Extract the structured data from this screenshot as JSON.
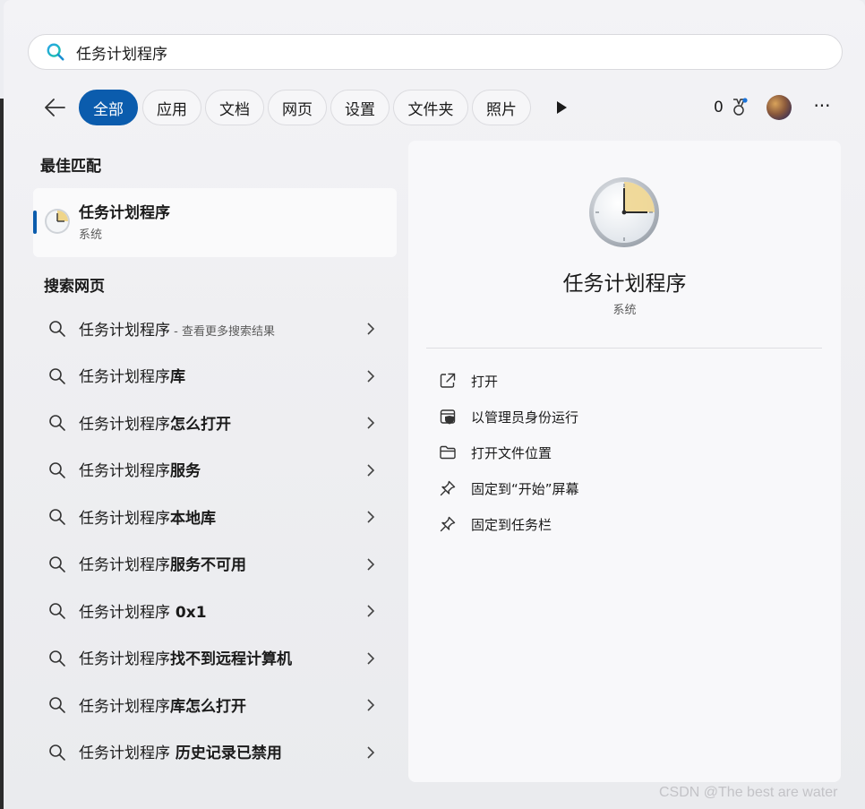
{
  "search": {
    "value": "任务计划程序",
    "icon": "search-icon"
  },
  "filters": {
    "tabs": [
      {
        "label": "全部",
        "active": true
      },
      {
        "label": "应用"
      },
      {
        "label": "文档"
      },
      {
        "label": "网页"
      },
      {
        "label": "设置"
      },
      {
        "label": "文件夹"
      },
      {
        "label": "照片"
      }
    ],
    "points": "0"
  },
  "best_match": {
    "heading": "最佳匹配",
    "title": "任务计划程序",
    "subtitle": "系统"
  },
  "web": {
    "heading": "搜索网页",
    "items": [
      {
        "base": "任务计划程序",
        "suffix": "",
        "hint": " - 查看更多搜索结果"
      },
      {
        "base": "任务计划程序",
        "suffix": "库",
        "hint": ""
      },
      {
        "base": "任务计划程序",
        "suffix": "怎么打开",
        "hint": ""
      },
      {
        "base": "任务计划程序",
        "suffix": "服务",
        "hint": ""
      },
      {
        "base": "任务计划程序",
        "suffix": "本地库",
        "hint": ""
      },
      {
        "base": "任务计划程序",
        "suffix": "服务不可用",
        "hint": ""
      },
      {
        "base": "任务计划程序",
        "suffix": " 0x1",
        "hint": ""
      },
      {
        "base": "任务计划程序",
        "suffix": "找不到远程计算机",
        "hint": ""
      },
      {
        "base": "任务计划程序",
        "suffix": "库怎么打开",
        "hint": ""
      },
      {
        "base": "任务计划程序",
        "suffix": " 历史记录已禁用",
        "hint": ""
      }
    ]
  },
  "preview": {
    "title": "任务计划程序",
    "subtitle": "系统",
    "actions": [
      {
        "label": "打开",
        "icon": "open-external-icon"
      },
      {
        "label": "以管理员身份运行",
        "icon": "admin-shield-icon"
      },
      {
        "label": "打开文件位置",
        "icon": "folder-icon"
      },
      {
        "label": "固定到“开始”屏幕",
        "icon": "pin-icon"
      },
      {
        "label": "固定到任务栏",
        "icon": "pin-icon"
      }
    ]
  },
  "watermark": "CSDN @The best are water",
  "colors": {
    "accent": "#0b5cad"
  }
}
